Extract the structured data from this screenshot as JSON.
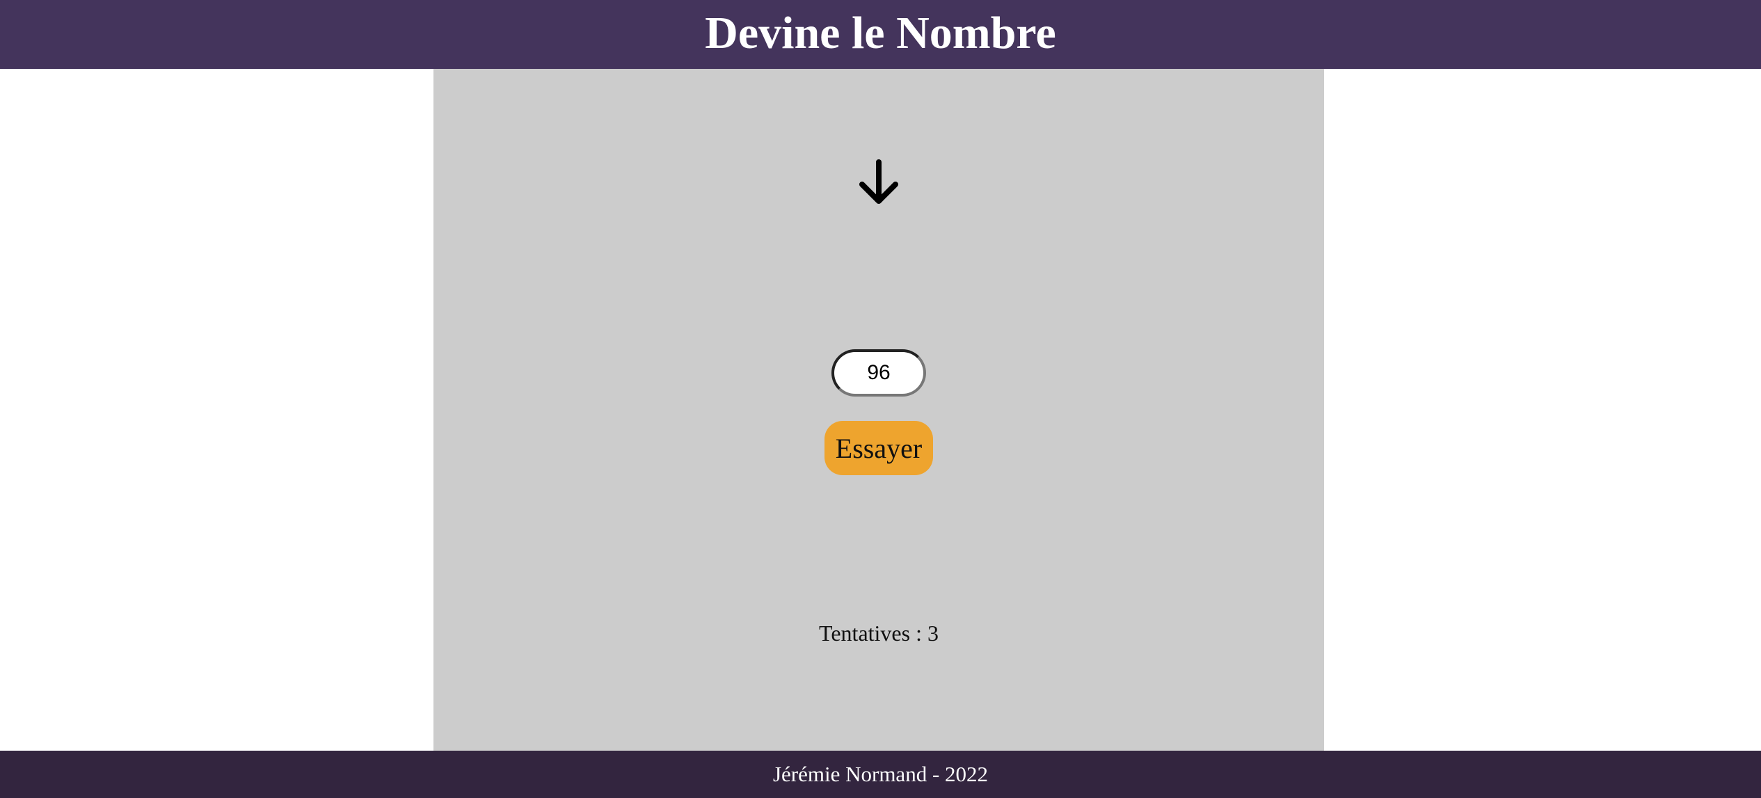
{
  "header": {
    "title": "Devine le Nombre"
  },
  "game": {
    "hint_icon": "arrow-down-icon",
    "guess_value": "96",
    "try_label": "Essayer",
    "attempts_text": "Tentatives : 3"
  },
  "footer": {
    "credit": "Jérémie Normand - 2022"
  },
  "colors": {
    "header_bg": "#44345c",
    "footer_bg": "#33253f",
    "panel_bg": "#cccccc",
    "button_bg": "#eea42e"
  }
}
